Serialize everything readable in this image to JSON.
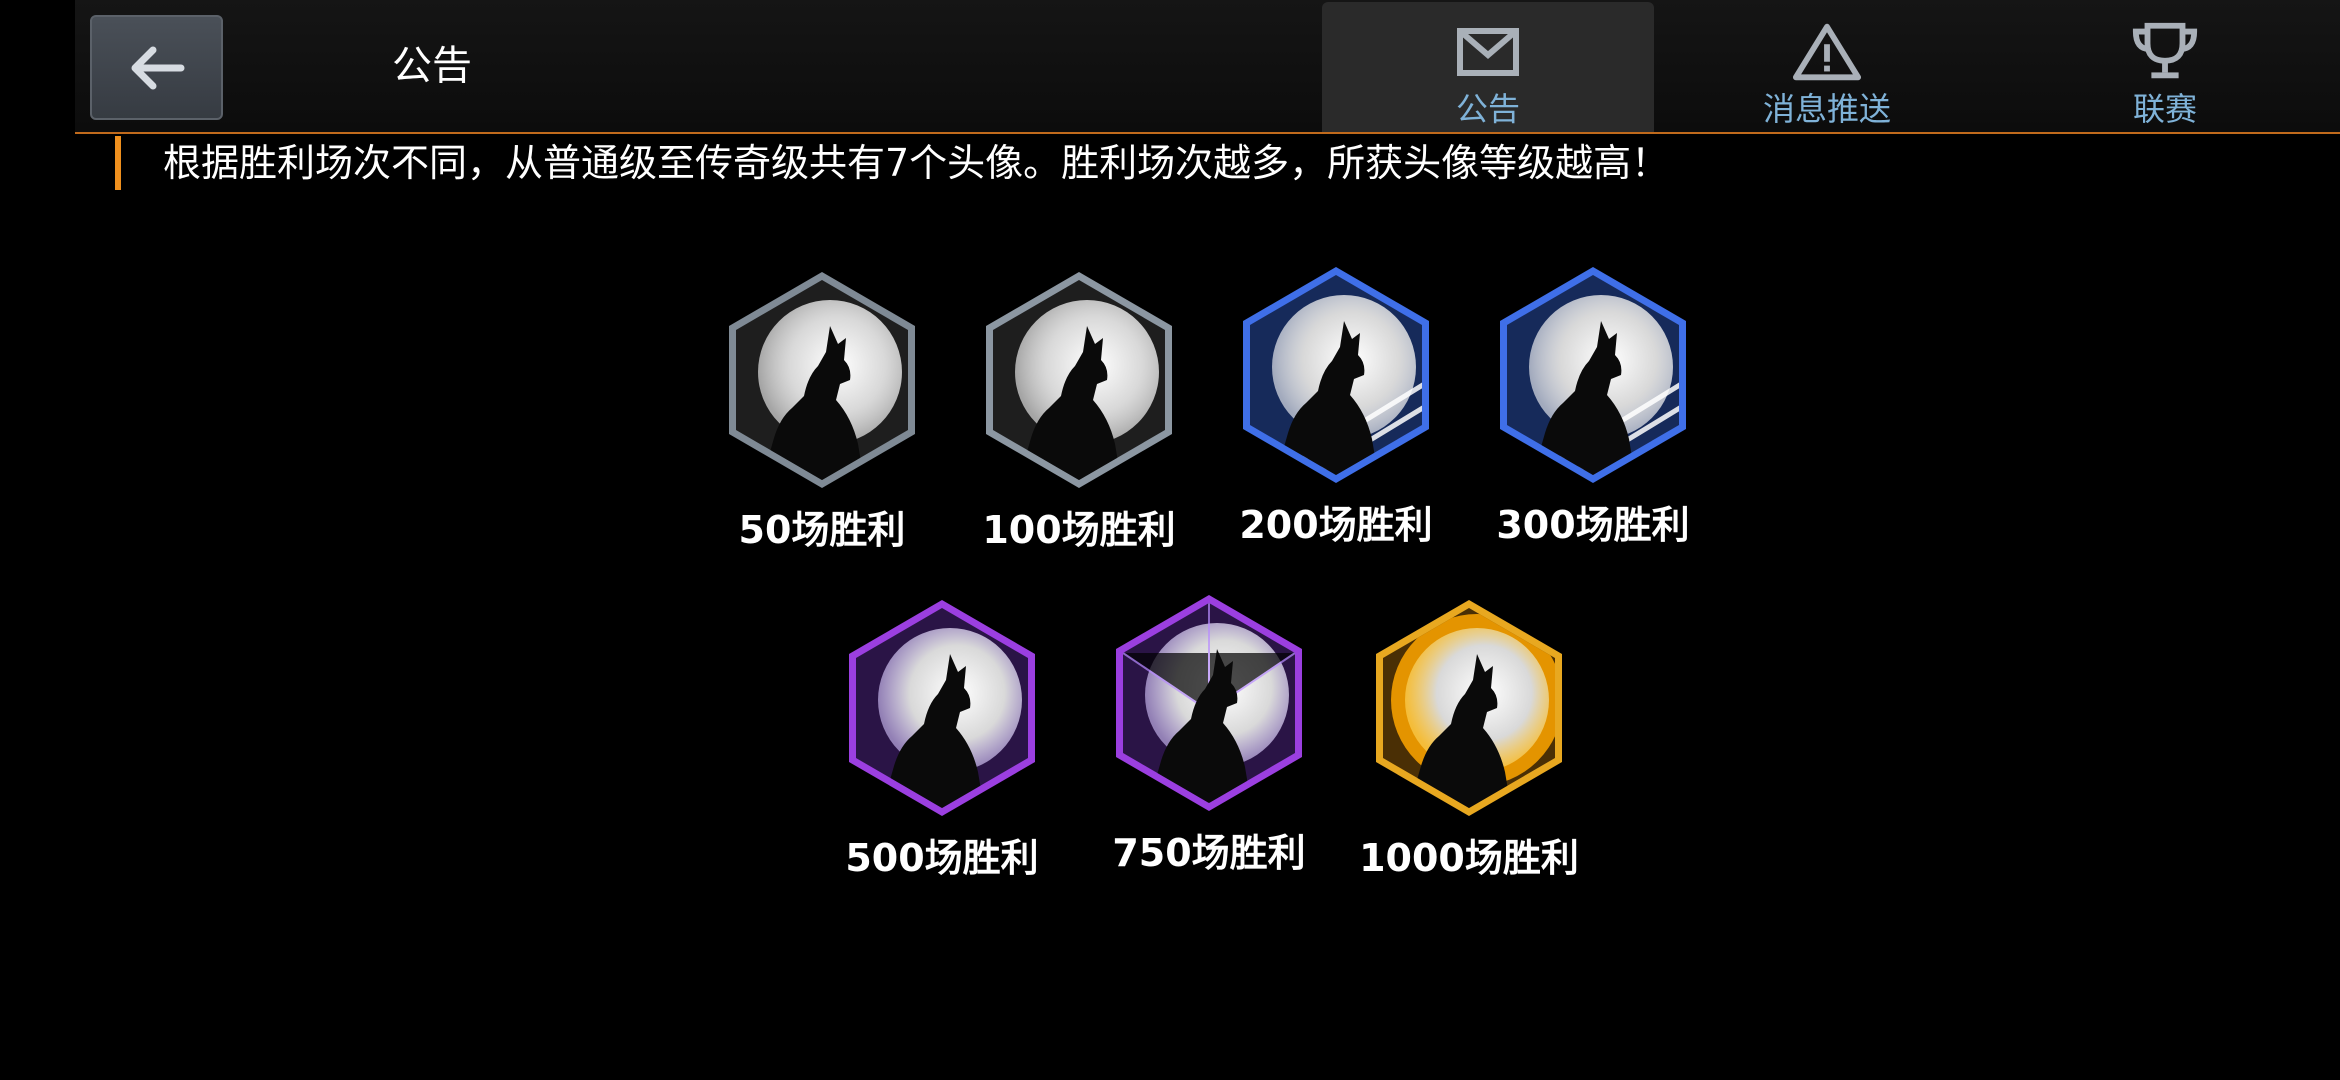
{
  "header": {
    "title": "公告",
    "tabs": [
      {
        "label": "公告",
        "icon": "mail-icon",
        "active": true
      },
      {
        "label": "消息推送",
        "icon": "warning-icon",
        "active": false
      },
      {
        "label": "联赛",
        "icon": "trophy-icon",
        "active": false
      }
    ],
    "accent_color": "#c06a1c"
  },
  "notice": {
    "text": "根据胜利场次不同，从普通级至传奇级共有7个头像。胜利场次越多，所获头像等级越高！",
    "bar_color": "#f0901e"
  },
  "badges": [
    {
      "label": "50场胜利",
      "tier": "common",
      "frame_color": "#7f8a95"
    },
    {
      "label": "100场胜利",
      "tier": "common",
      "frame_color": "#8c97a2"
    },
    {
      "label": "200场胜利",
      "tier": "rare",
      "frame_color": "#3f6fe8"
    },
    {
      "label": "300场胜利",
      "tier": "rare",
      "frame_color": "#3f6fe8"
    },
    {
      "label": "500场胜利",
      "tier": "epic",
      "frame_color": "#9b3fe0"
    },
    {
      "label": "750场胜利",
      "tier": "epic",
      "frame_color": "#9b3fe0"
    },
    {
      "label": "1000场胜利",
      "tier": "legendary",
      "frame_color": "#e8a820"
    }
  ]
}
